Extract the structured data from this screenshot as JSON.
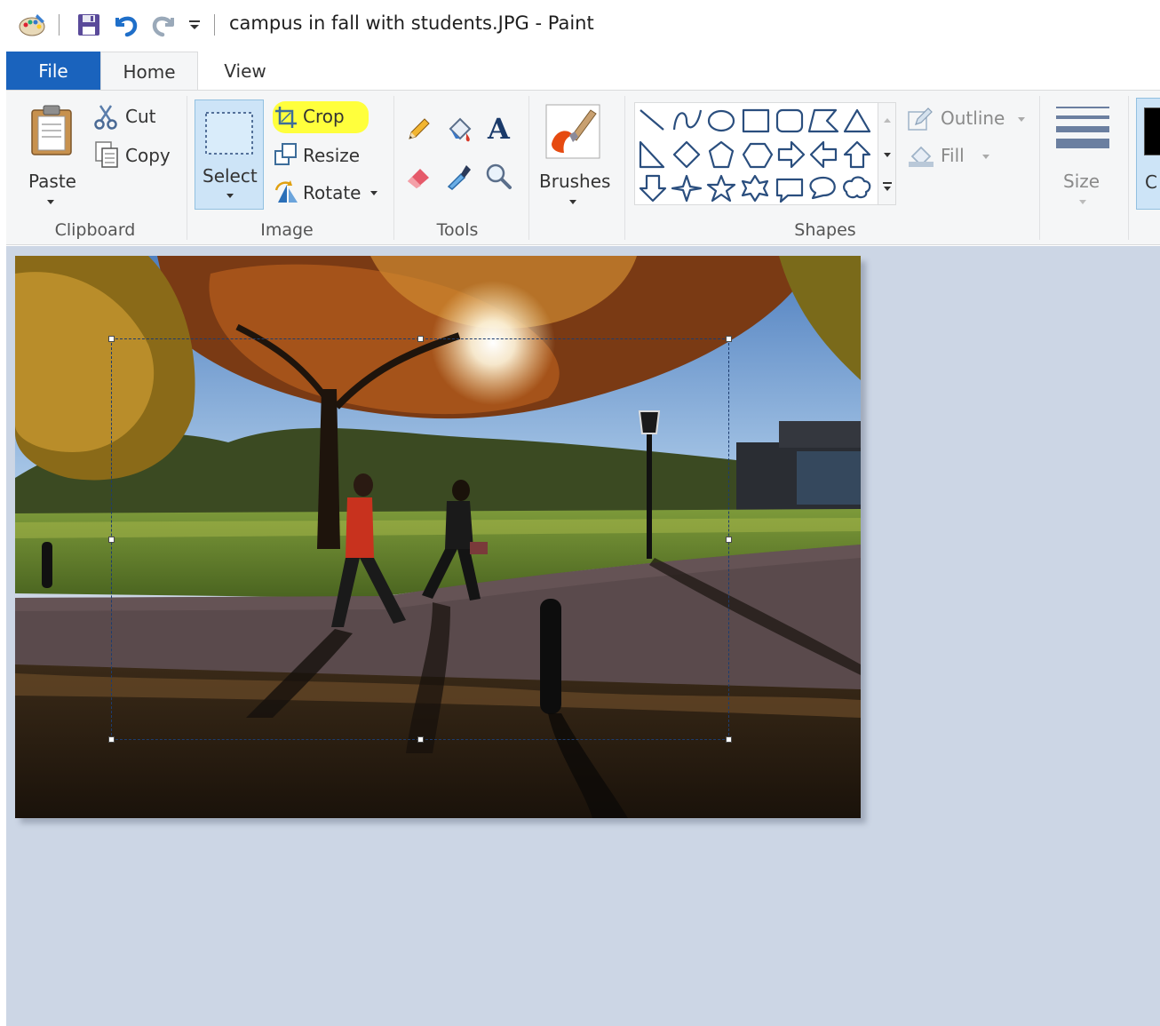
{
  "window": {
    "title": "campus in fall with students.JPG - Paint",
    "qat": {
      "app_icon": "paint-palette-icon",
      "save_icon": "floppy-disk-icon",
      "undo_icon": "undo-arrow-icon",
      "redo_icon": "redo-arrow-icon",
      "customize_icon": "qat-dropdown-icon"
    }
  },
  "tabs": {
    "file": "File",
    "home": "Home",
    "view": "View"
  },
  "ribbon": {
    "clipboard": {
      "group_label": "Clipboard",
      "paste": "Paste",
      "cut": "Cut",
      "copy": "Copy"
    },
    "image": {
      "group_label": "Image",
      "select": "Select",
      "crop": "Crop",
      "resize": "Resize",
      "rotate": "Rotate",
      "crop_highlight_color": "#ffff3c"
    },
    "tools": {
      "group_label": "Tools",
      "items": [
        "pencil-icon",
        "fill-bucket-icon",
        "text-icon",
        "eraser-icon",
        "color-picker-icon",
        "magnifier-icon"
      ],
      "text_glyph": "A"
    },
    "brushes": {
      "label": "Brushes"
    },
    "shapes": {
      "group_label": "Shapes",
      "outline": "Outline",
      "fill": "Fill",
      "items": [
        "line",
        "curve",
        "oval",
        "rectangle",
        "rounded-rectangle",
        "polygon",
        "triangle",
        "right-triangle",
        "diamond",
        "pentagon",
        "hexagon",
        "right-arrow",
        "left-arrow",
        "up-arrow",
        "down-arrow",
        "four-point-star",
        "five-point-star",
        "six-point-star",
        "rounded-callout",
        "oval-callout",
        "cloud-callout"
      ]
    },
    "size": {
      "label": "Size"
    },
    "colors": {
      "partial_label": "C",
      "color1": "#000000"
    }
  },
  "canvas": {
    "workspace_color": "#ccd6e5",
    "image_alt": "campus in fall with students photo",
    "has_selection": true
  }
}
